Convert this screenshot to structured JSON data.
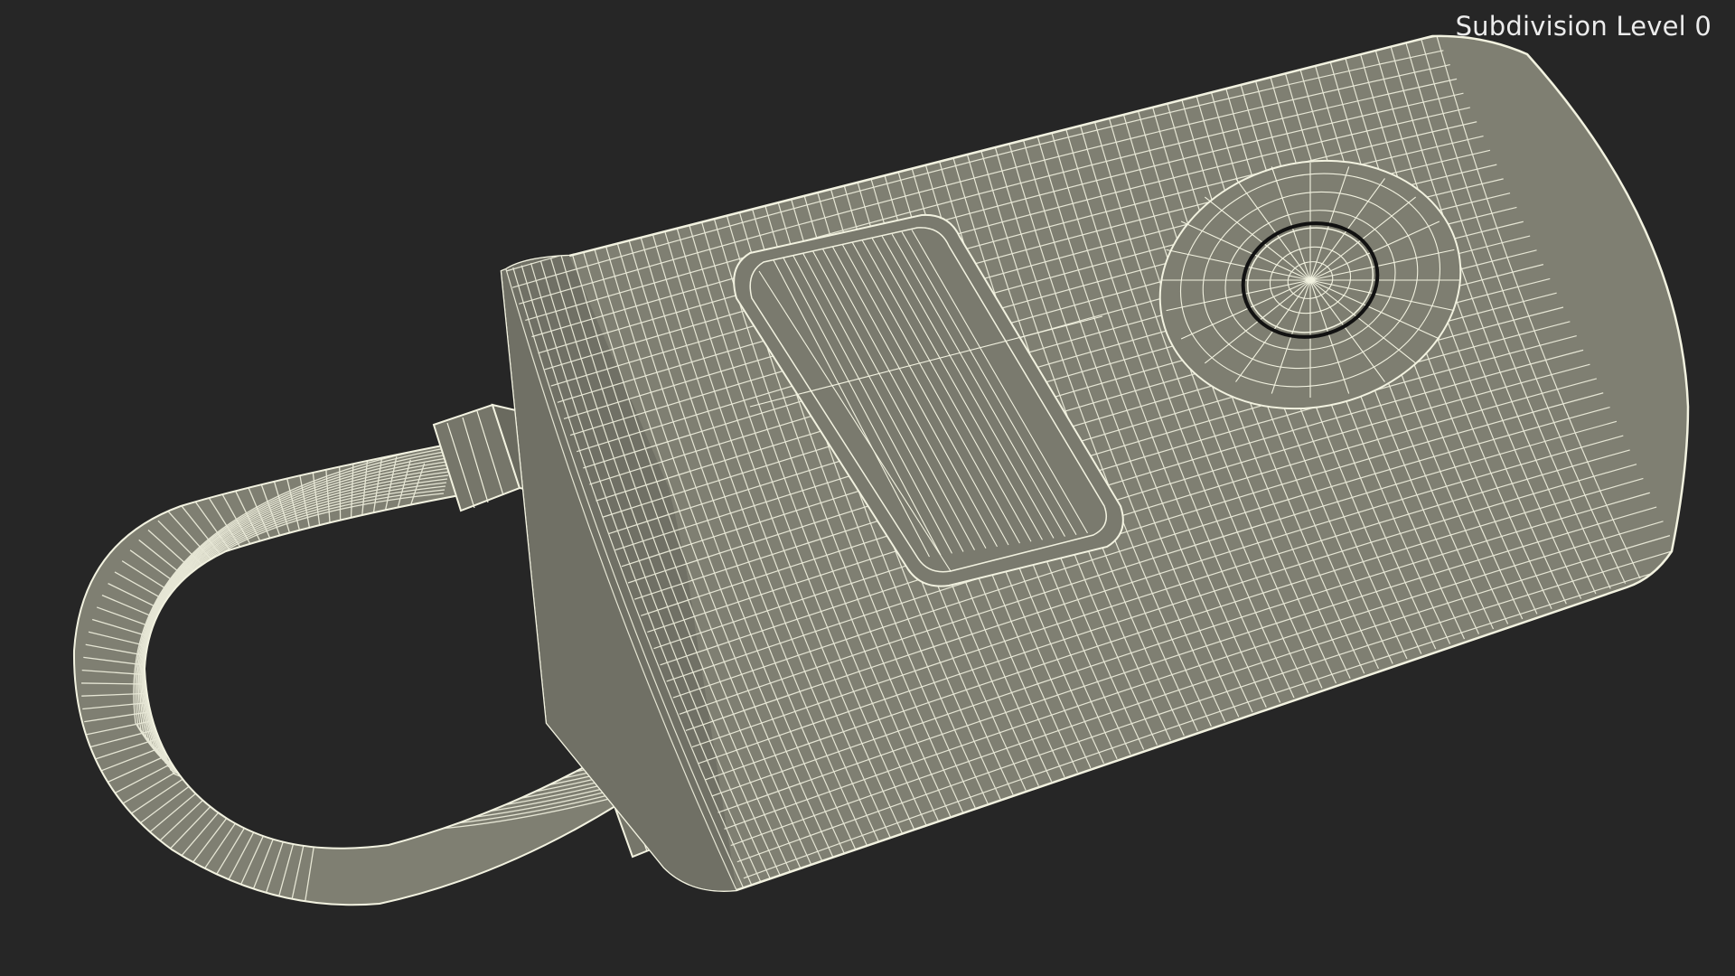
{
  "viewport": {
    "subdivision_label": "Subdivision Level 0",
    "background_color": "#262626",
    "mesh_fill_color": "#7f7f72",
    "mesh_shade_color": "#6e6e62",
    "wire_color": "#f2f2e0"
  },
  "model": {
    "icon": "padlock-wireframe-icon"
  }
}
